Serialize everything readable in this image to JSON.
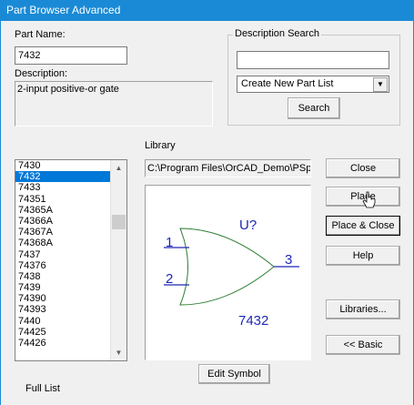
{
  "window": {
    "title": "Part Browser Advanced"
  },
  "part_name": {
    "label": "Part Name:",
    "value": "7432"
  },
  "description": {
    "label": "Description:",
    "value": "2-input positive-or gate"
  },
  "description_search": {
    "title": "Description Search",
    "input_value": "",
    "dropdown_value": "Create New Part List",
    "search_label": "Search"
  },
  "library": {
    "label": "Library",
    "path": "C:\\Program Files\\OrCAD_Demo\\PSpic"
  },
  "parts_list": {
    "items": [
      "7430",
      "7432",
      "7433",
      "74351",
      "74365A",
      "74366A",
      "74367A",
      "74368A",
      "7437",
      "74376",
      "7438",
      "7439",
      "74390",
      "74393",
      "7440",
      "74425",
      "74426"
    ],
    "selected_index": 1
  },
  "preview": {
    "ref": "U?",
    "value": "7432",
    "pins": [
      "1",
      "2",
      "3"
    ]
  },
  "buttons": {
    "close": "Close",
    "place": "Place",
    "place_close": "Place & Close",
    "help": "Help",
    "libraries": "Libraries...",
    "basic": "<< Basic",
    "edit_symbol": "Edit Symbol"
  },
  "footer": {
    "full_list": "Full List"
  },
  "colors": {
    "titlebar": "#1a8ad6",
    "selection": "#0078d7",
    "schematic_text": "#1e28b4",
    "gate_outline": "#2e7d32"
  }
}
